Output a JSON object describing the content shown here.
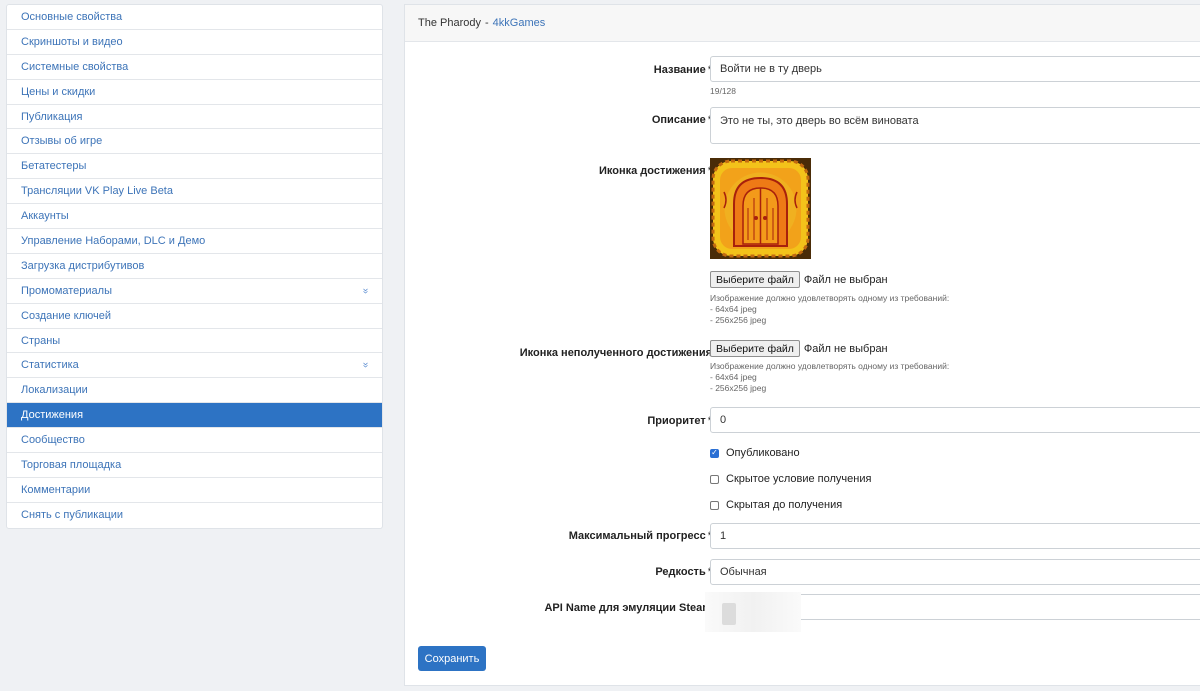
{
  "sidebar": {
    "items": [
      {
        "label": "Основные свойства"
      },
      {
        "label": "Скриншоты и видео"
      },
      {
        "label": "Системные свойства"
      },
      {
        "label": "Цены и скидки"
      },
      {
        "label": "Публикация"
      },
      {
        "label": "Отзывы об игре"
      },
      {
        "label": "Бетатестеры"
      },
      {
        "label": "Трансляции VK Play Live Beta"
      },
      {
        "label": "Аккаунты"
      },
      {
        "label": "Управление Наборами, DLC и Демо"
      },
      {
        "label": "Загрузка дистрибутивов"
      },
      {
        "label": "Промоматериалы",
        "expand": "»"
      },
      {
        "label": "Создание ключей"
      },
      {
        "label": "Страны"
      },
      {
        "label": "Статистика",
        "expand": "»"
      },
      {
        "label": "Локализации"
      },
      {
        "label": "Достижения",
        "active": true
      },
      {
        "label": "Сообщество"
      },
      {
        "label": "Торговая площадка"
      },
      {
        "label": "Комментарии"
      },
      {
        "label": "Снять с публикации"
      }
    ]
  },
  "header": {
    "game": "The Pharody",
    "separator": "-",
    "developer": "4kkGames"
  },
  "form": {
    "required_mark": "*",
    "name_label": "Название",
    "name_value": "Войти не в ту дверь",
    "name_counter": "19/128",
    "desc_label": "Описание",
    "desc_value": "Это не ты, это дверь во всём виновата",
    "icon_label": "Иконка достижения",
    "locked_icon_label": "Иконка неполученного достижения",
    "file_button": "Выберите файл",
    "file_status": "Файл не выбран",
    "hint_title": "Изображение должно удовлетворять одному из требований:",
    "hint_1": "- 64x64 jpeg",
    "hint_2": "- 256x256 jpeg",
    "priority_label": "Приоритет",
    "priority_value": "0",
    "published_label": "Опубликовано",
    "published_checked": true,
    "hidden_condition_label": "Скрытое условие получения",
    "hidden_condition_checked": false,
    "hidden_until_label": "Скрытая до получения",
    "hidden_until_checked": false,
    "max_progress_label": "Максимальный прогресс",
    "max_progress_value": "1",
    "rarity_label": "Редкость",
    "rarity_value": "Обычная",
    "api_name_label": "API Name для эмуляции Steam",
    "save_button": "Сохранить"
  },
  "colors": {
    "accent": "#2d73c4",
    "link": "#3d74b8",
    "icon_frame": "#f3c21a",
    "icon_inner": "#e85a10"
  },
  "icons": {
    "chevron": "chevron-double-down-icon",
    "achievement": "door-achievement-icon"
  }
}
